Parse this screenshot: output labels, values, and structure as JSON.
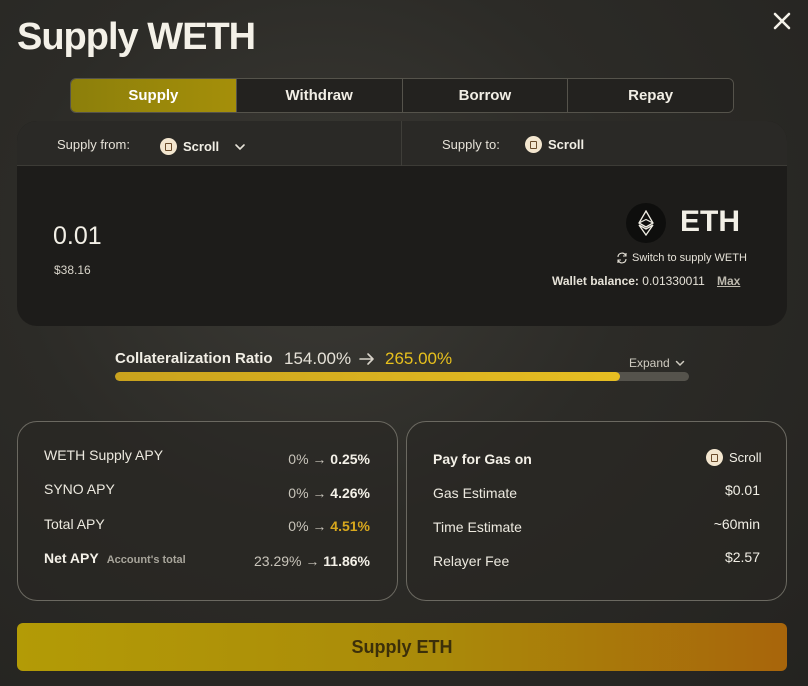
{
  "title": "Supply WETH",
  "tabs": [
    {
      "label": "Supply",
      "active": true
    },
    {
      "label": "Withdraw",
      "active": false
    },
    {
      "label": "Borrow",
      "active": false
    },
    {
      "label": "Repay",
      "active": false
    }
  ],
  "supply_from": {
    "label": "Supply from:",
    "chain": "Scroll"
  },
  "supply_to": {
    "label": "Supply to:",
    "chain": "Scroll"
  },
  "amount": {
    "value": "0.01",
    "usd": "$38.16"
  },
  "token": {
    "symbol": "ETH",
    "switch_label": "Switch to supply WETH"
  },
  "wallet": {
    "label": "Wallet balance:",
    "value": "0.01330011",
    "max_label": "Max"
  },
  "collateral": {
    "label": "Collateralization Ratio",
    "from": "154.00%",
    "to": "265.00%",
    "fill_percent": 88,
    "expand_label": "Expand"
  },
  "apy": {
    "weth": {
      "label": "WETH Supply APY",
      "from": "0%",
      "to": "0.25%"
    },
    "syno": {
      "label": "SYNO APY",
      "from": "0%",
      "to": "4.26%"
    },
    "total": {
      "label": "Total APY",
      "from": "0%",
      "to": "4.51%"
    },
    "net": {
      "label": "Net APY",
      "sub": "Account's total",
      "from": "23.29%",
      "to": "11.86%"
    }
  },
  "gas": {
    "pay_label": "Pay for Gas on",
    "pay_chain": "Scroll",
    "estimate_label": "Gas Estimate",
    "estimate_value": "$0.01",
    "time_label": "Time Estimate",
    "time_value": "~60min",
    "relayer_label": "Relayer Fee",
    "relayer_value": "$2.57"
  },
  "cta_label": "Supply ETH",
  "colors": {
    "accent": "#e7c01d",
    "tab_active": "#9a8a0a",
    "button_start": "#b39b06",
    "button_end": "#a8650b"
  }
}
